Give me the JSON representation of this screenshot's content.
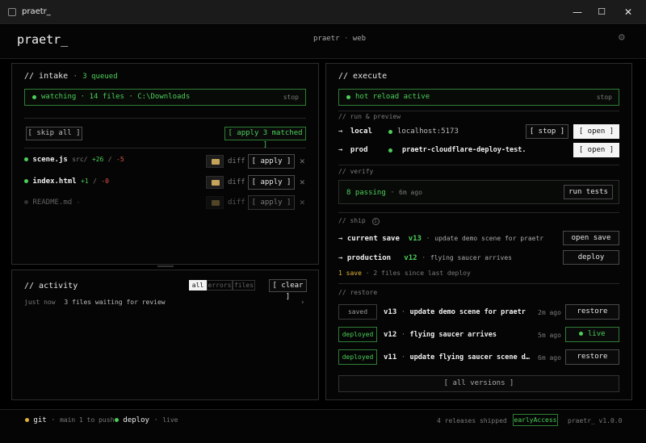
{
  "window": {
    "title": "praetr_",
    "minimize": "—",
    "maximize": "☐",
    "close": "✕"
  },
  "header": {
    "logo": "praetr_",
    "center_left": "praetr",
    "center_sep": "·",
    "center_right": "web",
    "settings_icon": "gear-icon"
  },
  "intake": {
    "title": "// intake",
    "sep": "·",
    "queued": "3 queued",
    "watch_bar": {
      "label": "watching",
      "files": "14 files",
      "path": "C:\\Downloads",
      "stop": "stop"
    },
    "skip_all": "[ skip all ]",
    "apply_matched": "[ apply 3 matched ]",
    "files": [
      {
        "name": "scene.js",
        "dir": "src/",
        "add": "+26",
        "slash": "/",
        "del": "-5",
        "diff": "diff",
        "apply": "[ apply ]",
        "active": true
      },
      {
        "name": "index.html",
        "dir": "",
        "add": "+1",
        "slash": "/",
        "del": "-0",
        "diff": "diff",
        "apply": "[ apply ]",
        "active": true
      },
      {
        "name": "README.md",
        "dir": "",
        "add": "",
        "slash": "",
        "del": "",
        "suffix": "-",
        "diff": "diff",
        "apply": "[ apply ]",
        "active": false
      }
    ]
  },
  "activity": {
    "title": "// activity",
    "filters": [
      "all",
      "errors",
      "files"
    ],
    "clear": "[ clear ]",
    "entries": [
      {
        "time": "just now",
        "text": "3 files waiting for review",
        "chevron": "›"
      }
    ]
  },
  "execute": {
    "title": "// execute",
    "hot_bar": {
      "label": "hot reload active",
      "stop": "stop"
    },
    "run_section": "// run & preview",
    "local": {
      "arrow": "→",
      "label": "local",
      "url": "localhost:5173",
      "stop": "[ stop ]",
      "open": "[ open ]"
    },
    "prod": {
      "arrow": "→",
      "label": "prod",
      "target": "praetr-cloudflare-deploy-test.",
      "open": "[ open ]"
    },
    "verify_section": "// verify",
    "verify": {
      "passing": "8 passing",
      "sep": "·",
      "ago": "6m ago",
      "run_tests": "run tests"
    },
    "ship_section": "// ship",
    "ship_info_icon": "info-icon",
    "current_save": {
      "arrow": "→",
      "label": "current save",
      "version": "v13",
      "sep": "·",
      "desc": "update demo scene for praetr",
      "button": "open save"
    },
    "production": {
      "arrow": "→",
      "label": "production",
      "version": "v12",
      "sep": "·",
      "desc": "flying saucer arrives",
      "button": "deploy"
    },
    "ship_note": {
      "saves": "1 save",
      "sep": "·",
      "changes": "2 files since last deploy"
    },
    "restore_section": "// restore",
    "restores": [
      {
        "status": "saved",
        "version": "v13",
        "sep": "·",
        "desc": "update demo scene for praetr",
        "ago": "2m ago",
        "button": "restore",
        "live": false
      },
      {
        "status": "deployed",
        "version": "v12",
        "sep": "·",
        "desc": "flying saucer arrives",
        "ago": "5m ago",
        "button": "live",
        "live": true
      },
      {
        "status": "deployed",
        "version": "v11",
        "sep": "·",
        "desc": "update flying saucer scene d…",
        "ago": "6m ago",
        "button": "restore",
        "live": false
      }
    ],
    "all_versions": "[ all versions ]"
  },
  "footer": {
    "git_label": "git",
    "git_sep": "·",
    "git_status": "main 1 to push",
    "deploy_label": "deploy",
    "deploy_sep": "·",
    "deploy_status": "live",
    "releases": "4 releases shipped",
    "badge": "earlyAccess",
    "version": "praetr_ v1.0.0"
  },
  "colors": {
    "green": "#4ccf5a",
    "yellow": "#e2b33a",
    "red": "#e0564c",
    "background": "#050505",
    "border": "#2d2d2d"
  }
}
